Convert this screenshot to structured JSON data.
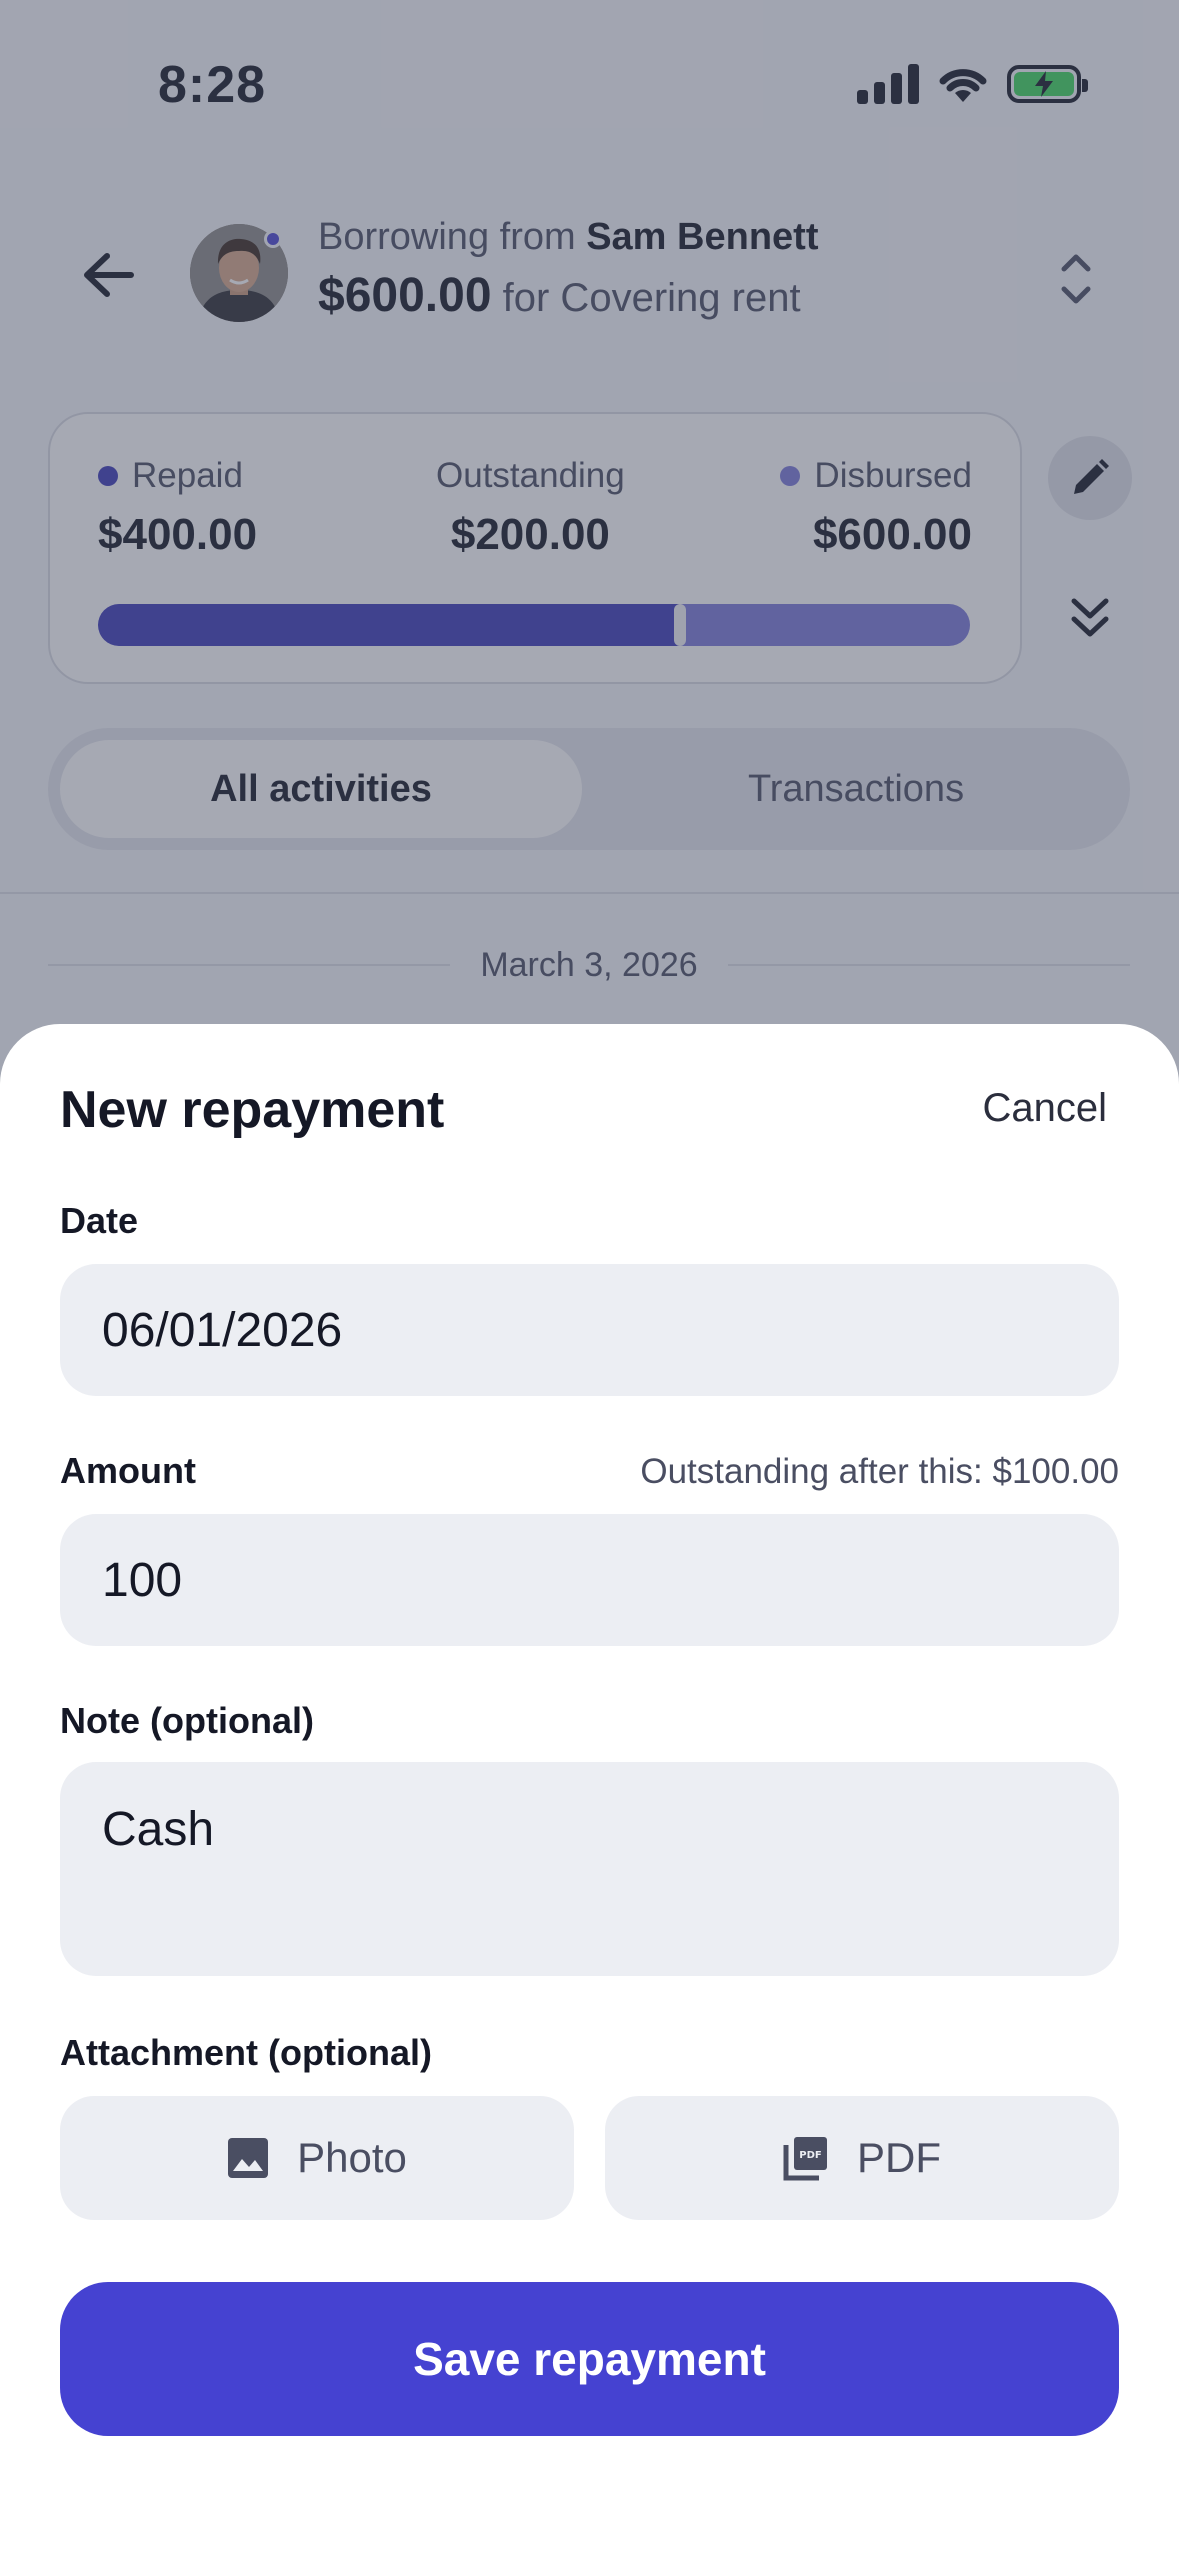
{
  "status_bar": {
    "time": "8:28"
  },
  "header": {
    "borrowing_prefix": "Borrowing from",
    "lender_name": "Sam Bennett",
    "amount": "$600.00",
    "purpose": "for Covering rent"
  },
  "summary": {
    "repaid_label": "Repaid",
    "repaid_value": "$400.00",
    "outstanding_label": "Outstanding",
    "outstanding_value": "$200.00",
    "disbursed_label": "Disbursed",
    "disbursed_value": "$600.00",
    "repaid_fraction": 0.667,
    "colors": {
      "repaid": "#3d3ab8",
      "disbursed": "#7b7ad9"
    }
  },
  "tabs": [
    {
      "label": "All activities",
      "active": true
    },
    {
      "label": "Transactions",
      "active": false
    }
  ],
  "activity": {
    "date_separator": "March 3, 2026"
  },
  "sheet": {
    "title": "New repayment",
    "cancel_label": "Cancel",
    "date_label": "Date",
    "date_value": "06/01/2026",
    "amount_label": "Amount",
    "amount_hint": "Outstanding after this: $100.00",
    "amount_value": "100",
    "note_label": "Note (optional)",
    "note_value": "Cash",
    "attachment_label": "Attachment (optional)",
    "photo_label": "Photo",
    "pdf_label": "PDF",
    "save_label": "Save repayment"
  },
  "icons": {
    "back": "arrow-left-icon",
    "switch": "chevron-up-down-icon",
    "edit": "pencil-icon",
    "expand": "double-chevron-down-icon",
    "photo": "image-icon",
    "pdf": "pdf-file-icon"
  },
  "accent_color": "#4542d1"
}
